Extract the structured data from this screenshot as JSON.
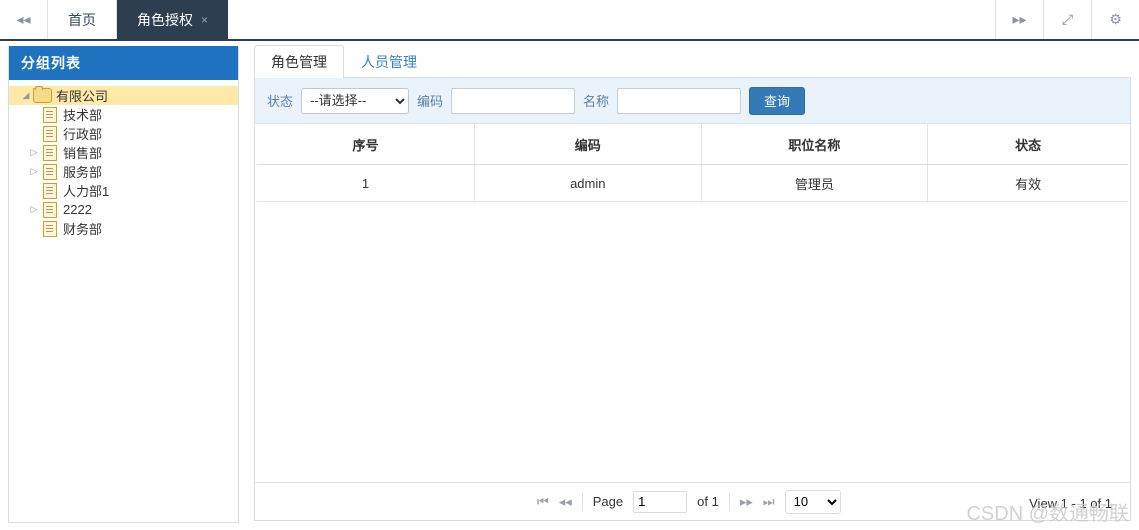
{
  "topbar": {
    "scroll_left_icon": "double-chevron-left-icon",
    "scroll_right_icon": "double-chevron-right-icon",
    "fullscreen_icon": "expand-icon",
    "settings_icon": "gear-icon",
    "tabs": [
      {
        "label": "首页",
        "active": false,
        "closable": false
      },
      {
        "label": "角色授权",
        "active": true,
        "closable": true,
        "close_label": "×"
      }
    ]
  },
  "sidebar": {
    "title": "分组列表",
    "tree": [
      {
        "label": "有限公司",
        "icon": "folder-icon",
        "level": 0,
        "expanded": true,
        "selected": true,
        "twisty": "◢"
      },
      {
        "label": "技术部",
        "icon": "document-icon",
        "level": 1,
        "twisty": ""
      },
      {
        "label": "行政部",
        "icon": "document-icon",
        "level": 1,
        "twisty": ""
      },
      {
        "label": "销售部",
        "icon": "document-icon",
        "level": 1,
        "twisty": "▷"
      },
      {
        "label": "服务部",
        "icon": "document-icon",
        "level": 1,
        "twisty": "▷"
      },
      {
        "label": "人力部1",
        "icon": "document-icon",
        "level": 1,
        "twisty": ""
      },
      {
        "label": "2222",
        "icon": "document-icon",
        "level": 1,
        "twisty": "▷"
      },
      {
        "label": "财务部",
        "icon": "document-icon",
        "level": 1,
        "twisty": ""
      }
    ]
  },
  "main": {
    "tabs": [
      {
        "label": "角色管理",
        "active": true
      },
      {
        "label": "人员管理",
        "active": false
      }
    ],
    "filter": {
      "status_label": "状态",
      "status_value": "--请选择--",
      "status_options": [
        "--请选择--"
      ],
      "code_label": "编码",
      "code_value": "",
      "code_placeholder": "",
      "name_label": "名称",
      "name_value": "",
      "name_placeholder": "",
      "search_button": "查询"
    },
    "table": {
      "columns": [
        "序号",
        "编码",
        "职位名称",
        "状态"
      ],
      "rows": [
        [
          "1",
          "admin",
          "管理员",
          "有效"
        ]
      ]
    },
    "pager": {
      "first_icon": "first-page-icon",
      "prev_icon": "previous-page-icon",
      "next_icon": "next-page-icon",
      "last_icon": "last-page-icon",
      "page_label": "Page",
      "page_value": "1",
      "of_label": "of 1",
      "page_size": "10",
      "page_size_options": [
        "10"
      ],
      "view_text": "View 1 - 1 of 1"
    }
  },
  "watermark": "CSDN @数通畅联",
  "colors": {
    "active_tab_bg": "#2c3e50",
    "sidebar_header_bg": "#1f72c0",
    "tree_selected_bg": "#ffe9a8",
    "filter_bg": "#eaf3fa",
    "primary_button_bg": "#337ab7"
  }
}
